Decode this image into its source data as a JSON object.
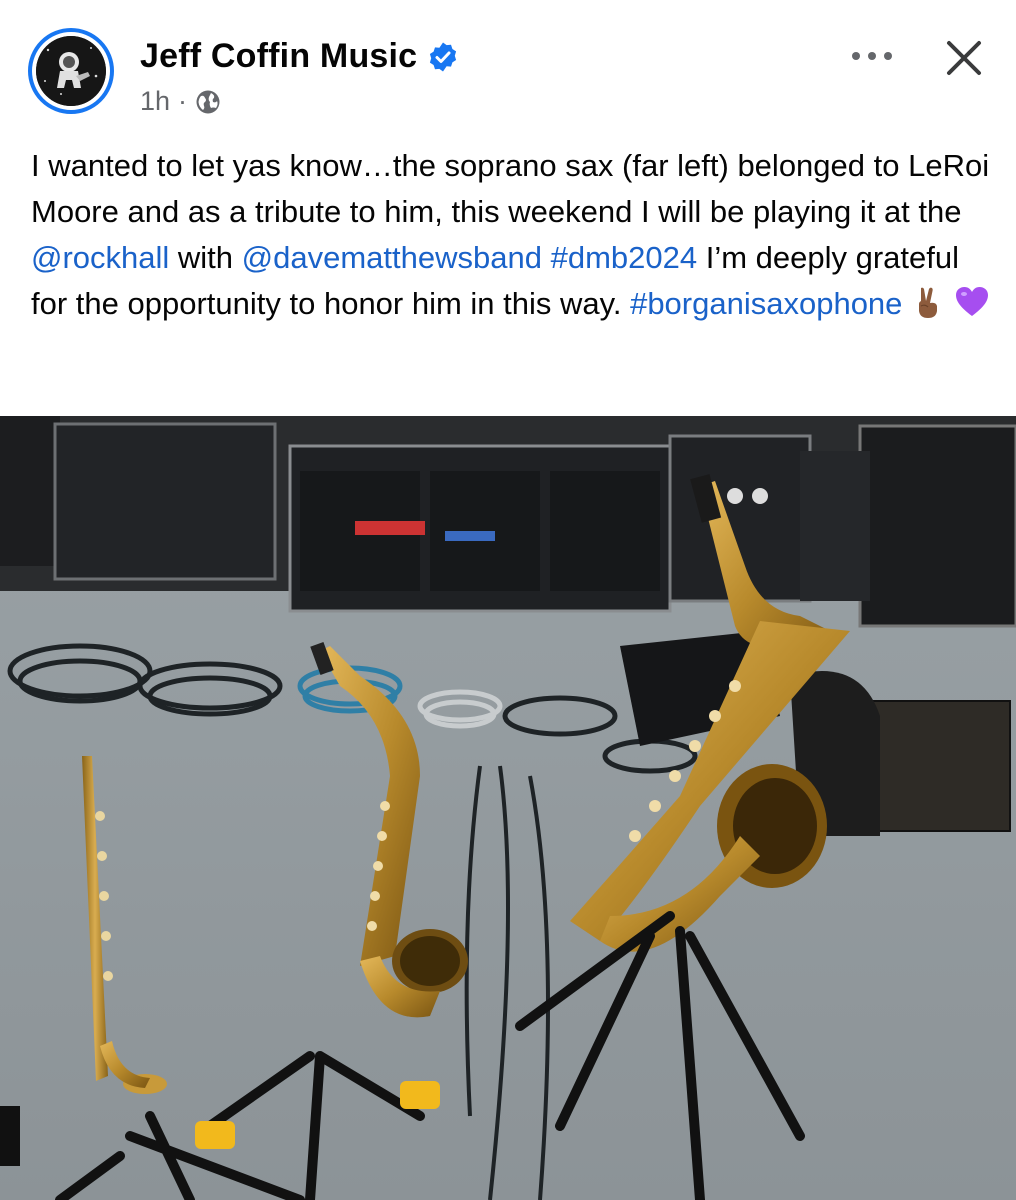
{
  "post": {
    "author": "Jeff Coffin Music",
    "time": "1h",
    "separator": "·",
    "caption_parts": {
      "p1": "I wanted to let yas know…the soprano sax (far left) belonged to LeRoi Moore and as a tribute to him, this weekend I will be playing it at the ",
      "mention1": "@rockhall",
      "p2": " with ",
      "mention2": "@davematthewsband",
      "p3": " ",
      "hashtag1": "#dmb2024",
      "p4": " I’m deeply grateful for the opportunity to honor him in this way. ",
      "hashtag2": "#borganisaxophone"
    },
    "emojis": [
      "peace-hand",
      "purple-heart"
    ]
  },
  "colors": {
    "verified": "#1877f2",
    "link": "#1a62c9",
    "meta": "#65676b"
  },
  "icons": [
    "verified-badge-icon",
    "globe-icon",
    "more-options-icon",
    "close-icon"
  ]
}
